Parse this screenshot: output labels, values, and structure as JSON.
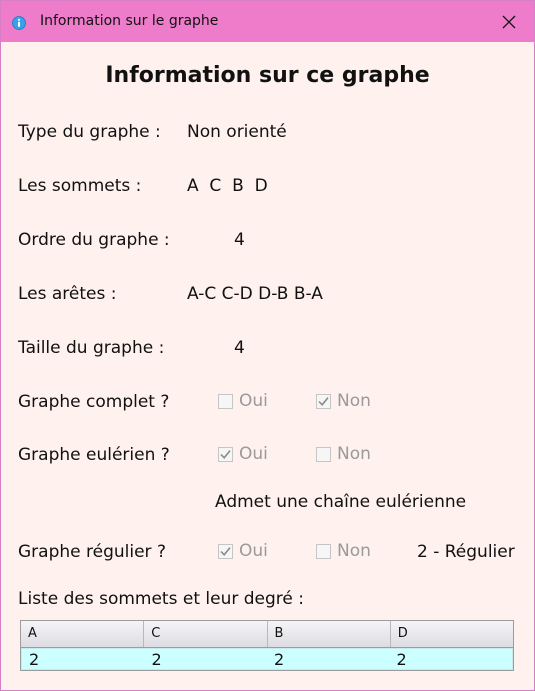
{
  "window": {
    "title": "Information sur le graphe"
  },
  "heading": "Information sur ce graphe",
  "fields": {
    "type": {
      "label": "Type du graphe :",
      "value": "Non orienté"
    },
    "sommets": {
      "label": "Les sommets :",
      "value": "A  C  B  D"
    },
    "ordre": {
      "label": "Ordre du graphe :",
      "value": "4"
    },
    "aretes": {
      "label": "Les arêtes :",
      "value": "A-C C-D D-B B-A"
    },
    "taille": {
      "label": "Taille du graphe :",
      "value": "4"
    }
  },
  "complet": {
    "label": "Graphe complet ?",
    "oui": "Oui",
    "non": "Non",
    "oui_checked": false,
    "non_checked": true
  },
  "eulerien": {
    "label": "Graphe eulérien ?",
    "oui": "Oui",
    "non": "Non",
    "oui_checked": true,
    "non_checked": false
  },
  "euler_note": "Admet une chaîne eulérienne",
  "regulier": {
    "label": "Graphe régulier ?",
    "oui": "Oui",
    "non": "Non",
    "oui_checked": true,
    "non_checked": false,
    "note": "2 - Régulier"
  },
  "degree_list": {
    "label": "Liste des sommets et leur degré :",
    "headers": [
      "A",
      "C",
      "B",
      "D"
    ],
    "row": [
      "2",
      "2",
      "2",
      "2"
    ]
  },
  "icons": {
    "title": "info-icon",
    "close": "close-icon",
    "check": "checkmark-icon"
  },
  "colors": {
    "titlebar": "#ef7ccb",
    "background": "#fff1ed",
    "table_row": "#ccffff"
  }
}
